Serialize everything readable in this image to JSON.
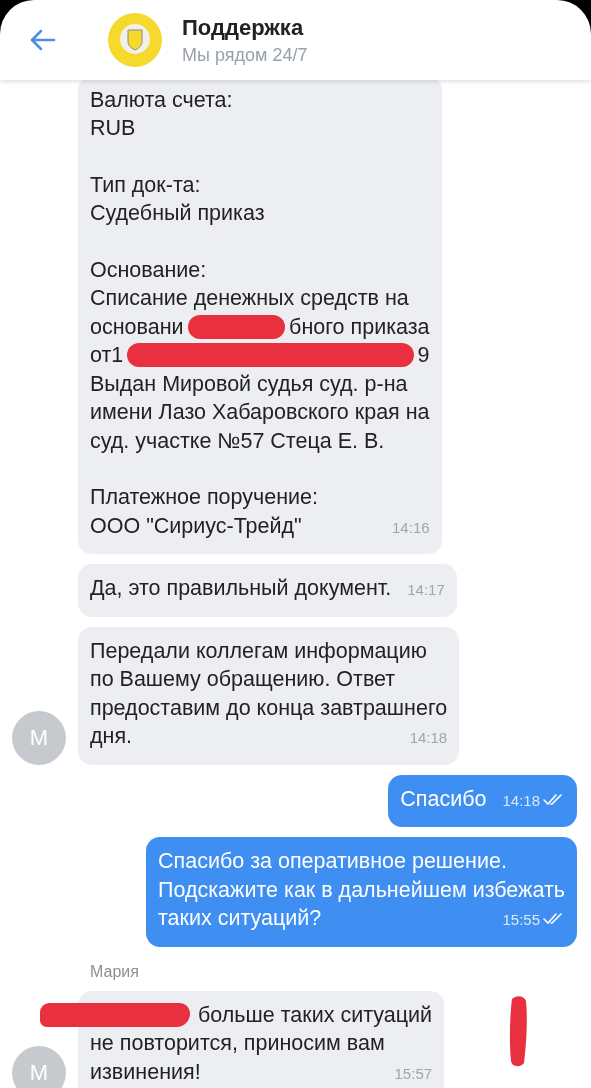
{
  "header": {
    "title": "Поддержка",
    "subtitle": "Мы рядом 24/7"
  },
  "messages": [
    {
      "kind": "incoming",
      "paragraphs": [
        [
          "Валюта счета:",
          "RUB"
        ],
        [
          "Тип док-та:",
          "Судебный приказ"
        ],
        [
          "Основание:",
          "Списание денежных средств на",
          {
            "parts": [
              "основани",
              "бного приказа"
            ]
          },
          {
            "parts": [
              "от1",
              "9"
            ]
          },
          "Выдан Мировой судья суд. р-на",
          "имени Лазо Хабаровского края на",
          "суд. участке №57 Стеца Е. В."
        ],
        [
          "Платежное поручение:",
          "ООО \"Сириус-Трейд\""
        ]
      ],
      "time": "14:16"
    },
    {
      "kind": "incoming",
      "paragraphs": [
        [
          "Да, это правильный документ."
        ]
      ],
      "time": "14:17"
    },
    {
      "kind": "incoming",
      "avatar": "M",
      "paragraphs": [
        [
          "Передали коллегам информацию",
          "по Вашему обращению. Ответ",
          "предоставим до конца завтрашнего",
          "дня."
        ]
      ],
      "time": "14:18"
    },
    {
      "kind": "outgoing",
      "paragraphs": [
        [
          "Спасибо"
        ]
      ],
      "time": "14:18",
      "read": true
    },
    {
      "kind": "outgoing",
      "paragraphs": [
        [
          "Спасибо за оперативное решение.",
          "Подскажите как в дальнейшем избежать",
          "таких ситуаций?"
        ]
      ],
      "time": "15:55",
      "read": true
    },
    {
      "kind": "incoming",
      "author": "Мария",
      "avatar": "M",
      "paragraphs": [
        [
          {
            "parts": [
              "больше таких ситуаций"
            ],
            "redacted_start": true
          },
          "не повторится, приносим вам",
          "извинения!"
        ]
      ],
      "time": "15:57"
    }
  ]
}
